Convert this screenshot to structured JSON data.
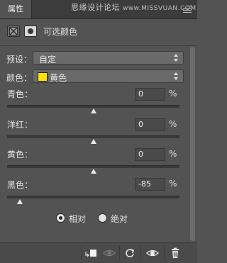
{
  "panel": {
    "tab_label": "属性",
    "watermark": "思缘设计论坛",
    "watermark_site": "www.MISSVUAN.COM",
    "title": "可选颜色"
  },
  "preset": {
    "label": "预设：",
    "value": "自定"
  },
  "colors": {
    "label": "颜色：",
    "value": "黄色",
    "swatch": "#ffe400"
  },
  "sliders": [
    {
      "label": "青色：",
      "value": "0",
      "unit": "%",
      "level": 0
    },
    {
      "label": "洋红：",
      "value": "0",
      "unit": "%",
      "level": 0
    },
    {
      "label": "黄色：",
      "value": "0",
      "unit": "%",
      "level": 0
    },
    {
      "label": "黑色：",
      "value": "-85",
      "unit": "%",
      "level": -85
    }
  ],
  "method": {
    "options": [
      {
        "label": "相对",
        "checked": true
      },
      {
        "label": "绝对",
        "checked": false
      }
    ]
  },
  "footer_icons": [
    "clip-to-layer-icon",
    "view-previous-icon",
    "reset-icon",
    "visibility-icon",
    "delete-icon"
  ]
}
